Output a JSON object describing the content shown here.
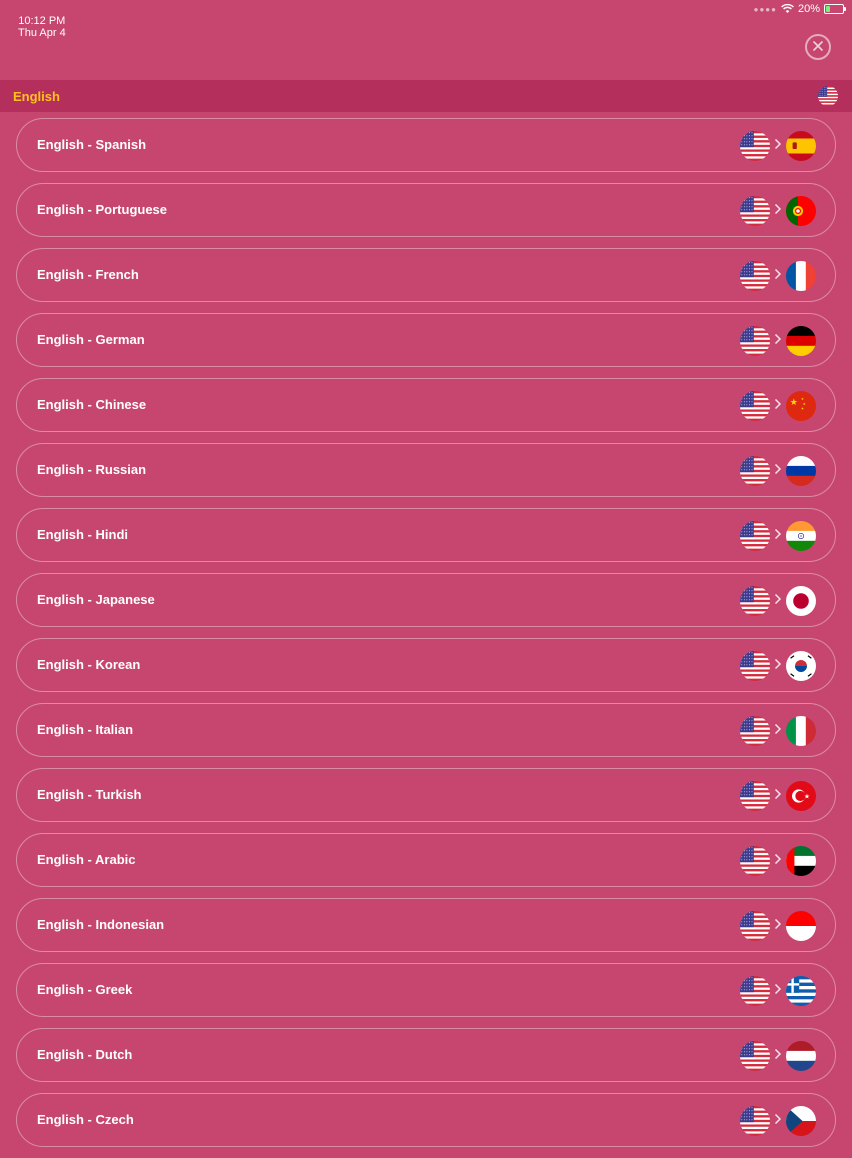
{
  "status_bar": {
    "time": "10:12 PM",
    "date": "Thu Apr 4",
    "battery": "20%"
  },
  "header": {
    "close_icon": "close-circle-icon"
  },
  "section": {
    "title": "English",
    "flag": "us"
  },
  "colors": {
    "background": "#c6466f",
    "header_band": "#b52f5c",
    "accent": "#ffc21a"
  },
  "pairs": [
    {
      "label": "English - Spanish",
      "from": "us",
      "to": "es"
    },
    {
      "label": "English - Portuguese",
      "from": "us",
      "to": "pt"
    },
    {
      "label": "English - French",
      "from": "us",
      "to": "fr"
    },
    {
      "label": "English - German",
      "from": "us",
      "to": "de"
    },
    {
      "label": "English - Chinese",
      "from": "us",
      "to": "cn"
    },
    {
      "label": "English - Russian",
      "from": "us",
      "to": "ru"
    },
    {
      "label": "English - Hindi",
      "from": "us",
      "to": "in"
    },
    {
      "label": "English - Japanese",
      "from": "us",
      "to": "jp"
    },
    {
      "label": "English - Korean",
      "from": "us",
      "to": "kr"
    },
    {
      "label": "English - Italian",
      "from": "us",
      "to": "it"
    },
    {
      "label": "English - Turkish",
      "from": "us",
      "to": "tr"
    },
    {
      "label": "English - Arabic",
      "from": "us",
      "to": "ae"
    },
    {
      "label": "English - Indonesian",
      "from": "us",
      "to": "id"
    },
    {
      "label": "English - Greek",
      "from": "us",
      "to": "gr"
    },
    {
      "label": "English - Dutch",
      "from": "us",
      "to": "nl"
    },
    {
      "label": "English - Czech",
      "from": "us",
      "to": "cz"
    }
  ]
}
